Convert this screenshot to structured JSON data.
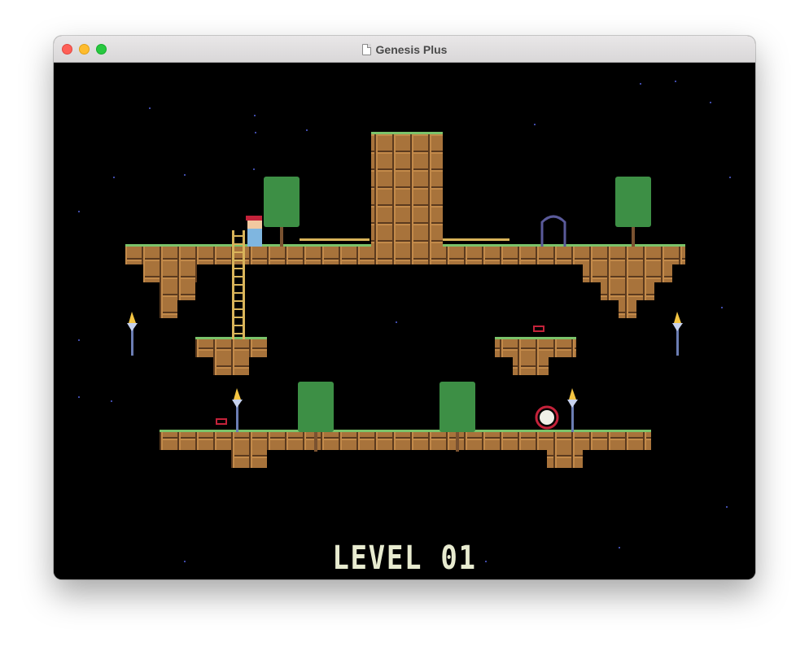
{
  "window": {
    "title": "Genesis Plus",
    "traffic_lights": {
      "close_color": "#fe5f57",
      "minimize_color": "#febc2e",
      "zoom_color": "#28c840"
    }
  },
  "game": {
    "level_label": "LEVEL 01",
    "colors": {
      "background": "#000000",
      "dirt": "#a8733b",
      "dirt_dark": "#5b3a1e",
      "grass": "#7bc36a",
      "tree": "#3d8f45",
      "ladder": "#d9b45a",
      "fence": "#d9b45a",
      "text": "#e8ebd0",
      "enemy_outline": "#c4223a"
    }
  }
}
